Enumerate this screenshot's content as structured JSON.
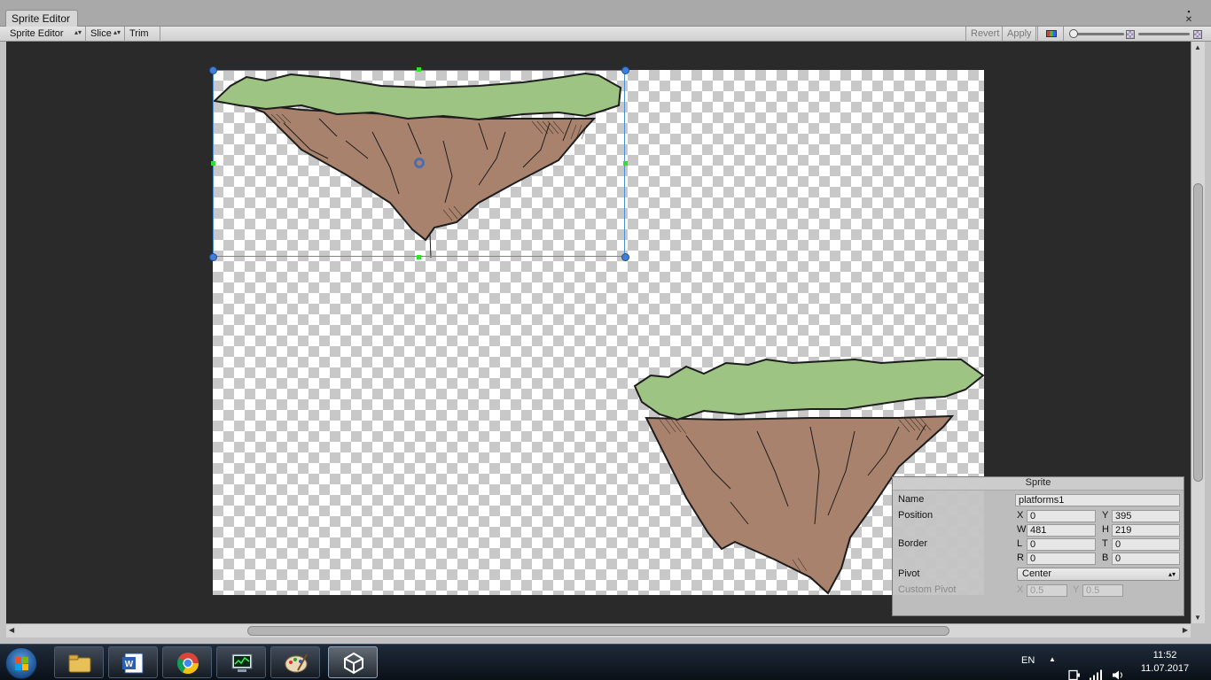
{
  "window": {
    "tab_title": "Sprite Editor"
  },
  "toolbar": {
    "mode_label": "Sprite Editor",
    "slice_label": "Slice",
    "trim_label": "Trim",
    "revert_label": "Revert",
    "apply_label": "Apply",
    "zoom_level": 0.0,
    "mip_level": 0.0
  },
  "sprite_panel": {
    "title": "Sprite",
    "name_label": "Name",
    "name_value": "platforms1",
    "position_label": "Position",
    "x_label": "X",
    "x_value": "0",
    "y_label": "Y",
    "y_value": "395",
    "w_label": "W",
    "w_value": "481",
    "h_label": "H",
    "h_value": "219",
    "border_label": "Border",
    "l_label": "L",
    "l_value": "0",
    "t_label": "T",
    "t_value": "0",
    "r_label": "R",
    "r_value": "0",
    "b_label": "B",
    "b_value": "0",
    "pivot_label": "Pivot",
    "pivot_value": "Center",
    "custom_pivot_label": "Custom Pivot",
    "cx_label": "X",
    "cx_value": "0.5",
    "cy_label": "Y",
    "cy_value": "0.5"
  },
  "taskbar": {
    "language": "EN",
    "time": "11:52",
    "date": "11.07.2017",
    "apps": [
      "file-explorer-icon",
      "word-icon",
      "chrome-icon",
      "task-manager-icon",
      "paint-icon",
      "unity-icon"
    ]
  },
  "colors": {
    "grass": "#9dc483",
    "rock": "#a8826c",
    "selection": "#4c8fd6",
    "handle": "#3f7fd9",
    "mid_handle": "#2fe02f"
  }
}
